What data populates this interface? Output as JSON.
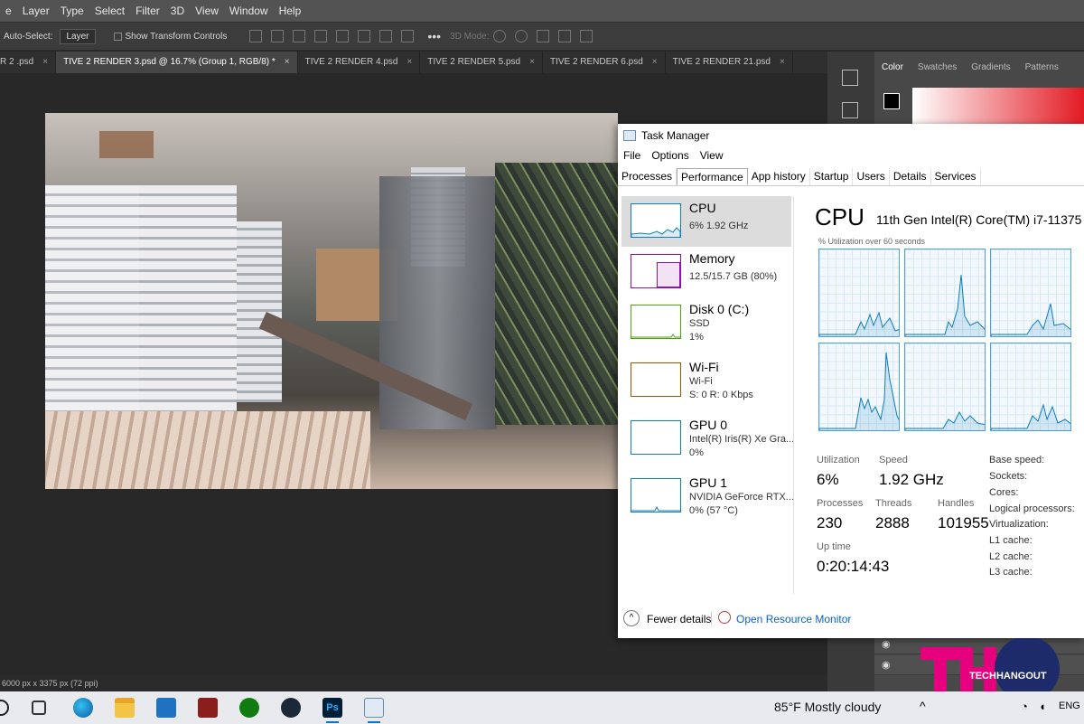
{
  "photoshop": {
    "menu": [
      "e",
      "Layer",
      "Type",
      "Select",
      "Filter",
      "3D",
      "View",
      "Window",
      "Help"
    ],
    "options": {
      "auto_select_label": "Auto-Select:",
      "auto_select_value": "Layer",
      "transform_label": "Show Transform Controls",
      "mode_label": "3D Mode:"
    },
    "doc_tabs": [
      {
        "label": "R 2 .psd",
        "active": false
      },
      {
        "label": "TIVE 2 RENDER 3.psd @ 16.7% (Group 1, RGB/8) *",
        "active": true
      },
      {
        "label": "TIVE 2 RENDER 4.psd",
        "active": false
      },
      {
        "label": "TIVE 2 RENDER 5.psd",
        "active": false
      },
      {
        "label": "TIVE 2 RENDER 6.psd",
        "active": false
      },
      {
        "label": "TIVE 2 RENDER 21.psd",
        "active": false
      }
    ],
    "status": "6000 px x 3375 px (72 ppi)",
    "panel_tabs": [
      "Color",
      "Swatches",
      "Gradients",
      "Patterns"
    ]
  },
  "task_manager": {
    "title": "Task Manager",
    "menu": [
      "File",
      "Options",
      "View"
    ],
    "tabs": [
      "Processes",
      "Performance",
      "App history",
      "Startup",
      "Users",
      "Details",
      "Services"
    ],
    "active_tab": "Performance",
    "sidebar": [
      {
        "name": "CPU",
        "line1": "6%  1.92 GHz",
        "line2": "",
        "color": "#117dbb"
      },
      {
        "name": "Memory",
        "line1": "12.5/15.7 GB (80%)",
        "line2": "",
        "color": "#8b12ae"
      },
      {
        "name": "Disk 0 (C:)",
        "line1": "SSD",
        "line2": "1%",
        "color": "#4da60c"
      },
      {
        "name": "Wi-Fi",
        "line1": "Wi-Fi",
        "line2": "S: 0  R: 0 Kbps",
        "color": "#a74f01"
      },
      {
        "name": "GPU 0",
        "line1": "Intel(R) Iris(R) Xe Gra...",
        "line2": "0%",
        "color": "#117dbb"
      },
      {
        "name": "GPU 1",
        "line1": "NVIDIA GeForce RTX...",
        "line2": "0% (57 °C)",
        "color": "#117dbb"
      }
    ],
    "detail": {
      "heading": "CPU",
      "model": "11th Gen Intel(R) Core(TM) i7-11375",
      "graph_label": "% Utilization over 60 seconds",
      "utilization_label": "Utilization",
      "utilization": "6%",
      "speed_label": "Speed",
      "speed": "1.92 GHz",
      "processes_label": "Processes",
      "processes": "230",
      "threads_label": "Threads",
      "threads": "2888",
      "handles_label": "Handles",
      "handles": "101955",
      "uptime_label": "Up time",
      "uptime": "0:20:14:43",
      "specs": [
        "Base speed:",
        "Sockets:",
        "Cores:",
        "Logical processors:",
        "Virtualization:",
        "L1 cache:",
        "L2 cache:",
        "L3 cache:"
      ]
    },
    "footer": {
      "fewer_details": "Fewer details",
      "open_resource_monitor": "Open Resource Monitor"
    }
  },
  "taskbar": {
    "weather": "85°F  Mostly cloudy",
    "language": "ENG",
    "apps": [
      "search-icon",
      "task-view-icon",
      "edge-icon",
      "file-explorer-icon",
      "mail-icon",
      "app-icon",
      "xbox-icon",
      "steam-icon",
      "photoshop-icon",
      "task-manager-icon"
    ]
  },
  "watermark": {
    "mark": "TH",
    "text": "TECHHANGOUT",
    "colors": {
      "magenta": "#e6007e",
      "navy": "#1d2b6b"
    }
  },
  "colors": {
    "accent": "#0078d4",
    "cpu_graph": "#117dbb",
    "link": "#0a63c4"
  }
}
